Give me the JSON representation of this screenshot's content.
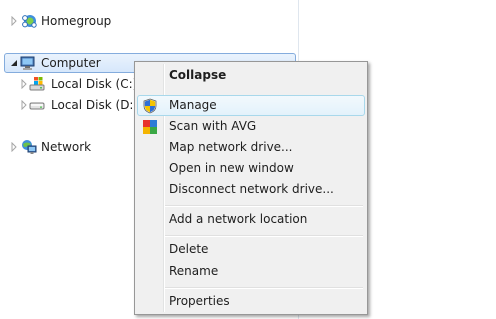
{
  "tree": {
    "homegroup": {
      "label": "Homegroup",
      "icon": "homegroup-icon"
    },
    "computer": {
      "label": "Computer",
      "icon": "computer-icon"
    },
    "disk_c": {
      "label": "Local Disk (C:)",
      "icon": "local-disk-windows-icon"
    },
    "disk_d": {
      "label": "Local Disk (D:)",
      "icon": "local-disk-icon"
    },
    "network": {
      "label": "Network",
      "icon": "network-icon"
    }
  },
  "context_menu": {
    "collapse": "Collapse",
    "manage": "Manage",
    "scan_avg": "Scan with AVG",
    "map_drive": "Map network drive...",
    "open_new_window": "Open in new window",
    "disconnect_drive": "Disconnect network drive...",
    "add_network_location": "Add a network location",
    "delete": "Delete",
    "rename": "Rename",
    "properties": "Properties"
  },
  "colors": {
    "selection_border": "#84acdd",
    "hover_border": "#a8d8eb",
    "menu_background": "#f0f0f0"
  }
}
